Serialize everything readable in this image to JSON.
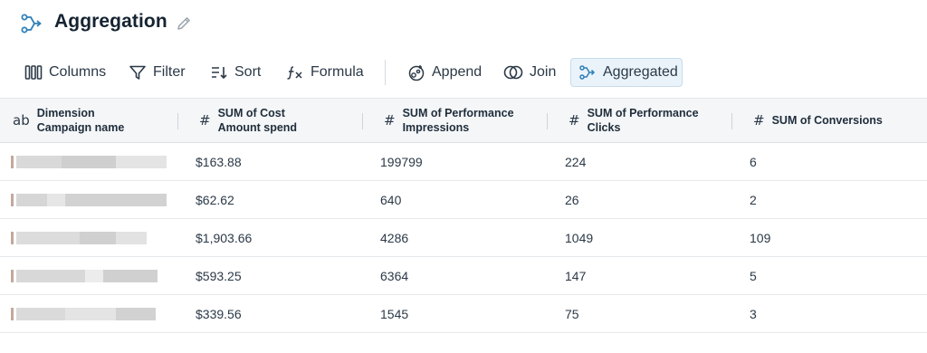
{
  "header": {
    "title": "Aggregation"
  },
  "toolbar": {
    "columns_label": "Columns",
    "filter_label": "Filter",
    "sort_label": "Sort",
    "formula_label": "Formula",
    "append_label": "Append",
    "join_label": "Join",
    "aggregated_label": "Aggregated"
  },
  "table": {
    "columns": [
      {
        "type": "ab",
        "line1": "Dimension",
        "line2": "Campaign name"
      },
      {
        "type": "#",
        "line1": "SUM of Cost",
        "line2": "Amount spend"
      },
      {
        "type": "#",
        "line1": "SUM of Performance",
        "line2": "Impressions"
      },
      {
        "type": "#",
        "line1": "SUM of Performance",
        "line2": "Clicks"
      },
      {
        "type": "#",
        "line1": "SUM of Conversions",
        "line2": ""
      }
    ],
    "rows": [
      {
        "cost": "$163.88",
        "impressions": "199799",
        "clicks": "224",
        "conversions": "6"
      },
      {
        "cost": "$62.62",
        "impressions": "640",
        "clicks": "26",
        "conversions": "2"
      },
      {
        "cost": "$1,903.66",
        "impressions": "4286",
        "clicks": "1049",
        "conversions": "109"
      },
      {
        "cost": "$593.25",
        "impressions": "6364",
        "clicks": "147",
        "conversions": "5"
      },
      {
        "cost": "$339.56",
        "impressions": "1545",
        "clicks": "75",
        "conversions": "3"
      }
    ]
  },
  "colors": {
    "accent": "#2f7fb8",
    "active_bg": "#eaf3fa",
    "header_bg": "#f4f6f8"
  },
  "icons": [
    "aggregation-icon",
    "pencil-icon",
    "columns-icon",
    "filter-icon",
    "sort-icon",
    "formula-icon",
    "append-icon",
    "join-icon",
    "aggregated-icon"
  ]
}
